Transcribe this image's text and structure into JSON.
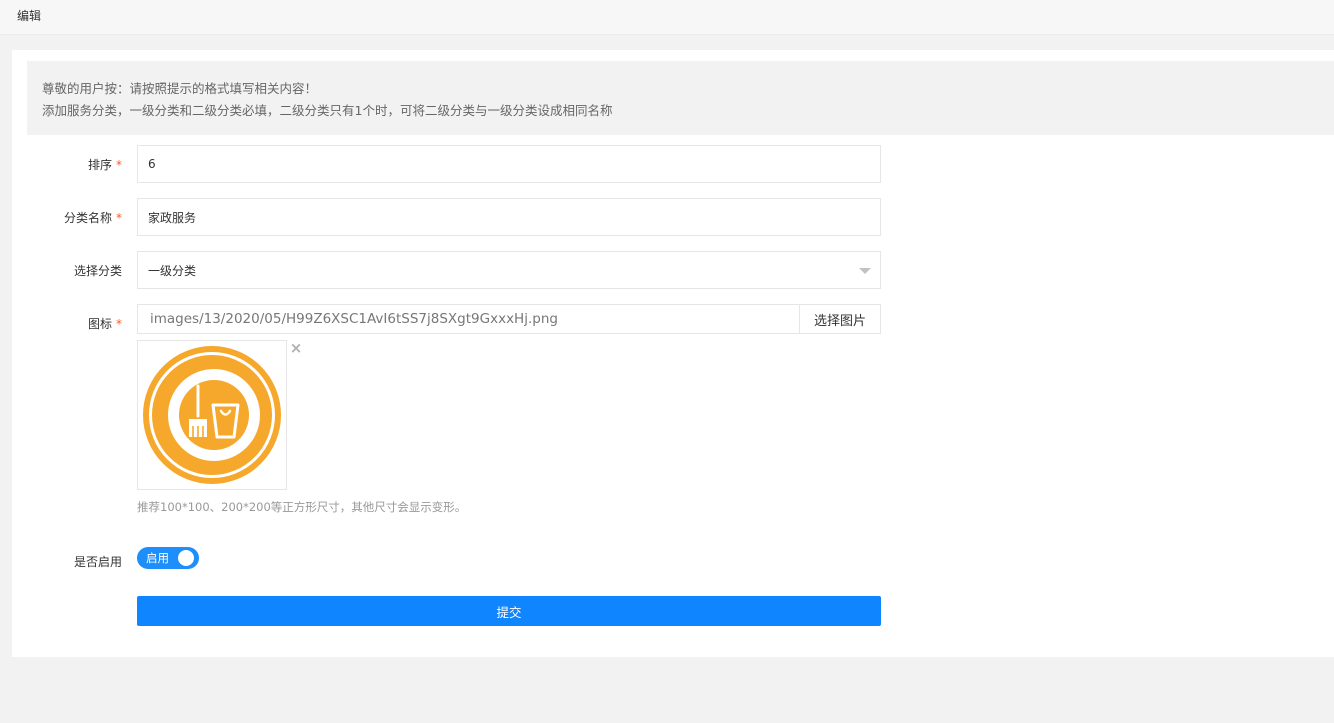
{
  "header": {
    "title": "编辑"
  },
  "notice": {
    "line1": "尊敬的用户按：请按照提示的格式填写相关内容！",
    "line2": "添加服务分类，一级分类和二级分类必填，二级分类只有1个时，可将二级分类与一级分类设成相同名称"
  },
  "form": {
    "sort": {
      "label": "排序",
      "required_mark": "*",
      "value": "6"
    },
    "name": {
      "label": "分类名称",
      "required_mark": "*",
      "value": "家政服务"
    },
    "category": {
      "label": "选择分类",
      "selected": "一级分类"
    },
    "icon": {
      "label": "图标",
      "required_mark": "*",
      "path": "images/13/2020/05/H99Z6XSC1AvI6tSS7j8SXgt9GxxxHj.png",
      "pick_label": "选择图片",
      "remove_glyph": "×",
      "hint": "推荐100*100、200*200等正方形尺寸，其他尺寸会显示变形。"
    },
    "enabled": {
      "label": "是否启用",
      "switch_text": "启用",
      "on": true
    },
    "submit_label": "提交"
  },
  "colors": {
    "accent": "#0f86ff",
    "required": "#ff5722",
    "icon_orange": "#f6a82c"
  },
  "icons": {
    "preview": "broom-bucket-icon",
    "select": "caret-down-icon",
    "remove": "close-icon"
  }
}
